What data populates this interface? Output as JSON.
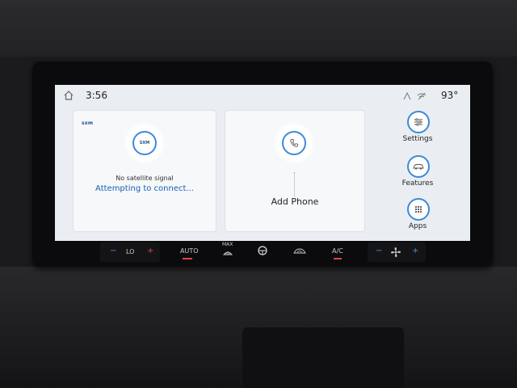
{
  "status_bar": {
    "time": "3:56",
    "temperature": "93°"
  },
  "radio_card": {
    "brand": "sxm",
    "status": "No satellite signal",
    "action": "Attempting to connect..."
  },
  "phone_card": {
    "label": "Add Phone"
  },
  "side_menu": [
    {
      "label": "Settings",
      "icon": "sliders-icon"
    },
    {
      "label": "Features",
      "icon": "car-icon"
    },
    {
      "label": "Apps",
      "icon": "grid-icon"
    }
  ],
  "hvac": {
    "lo": "LO",
    "auto": "AUTO",
    "max": "MAX",
    "ac": "A/C"
  },
  "colors": {
    "accent": "#3d8ad9",
    "link": "#1a5fb4",
    "screen": "#eaeef2"
  }
}
